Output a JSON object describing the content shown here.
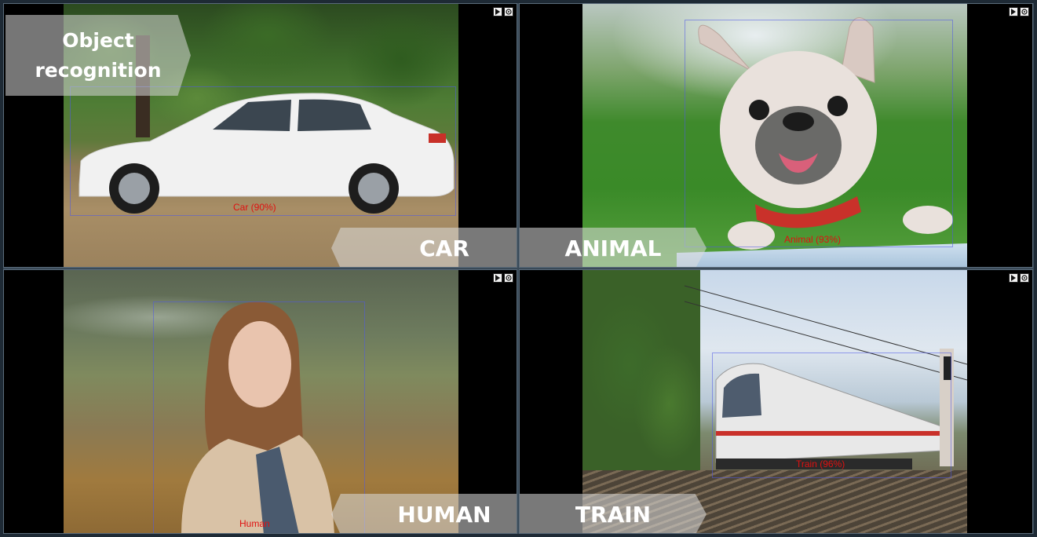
{
  "title": "Object\nrecognition",
  "title_lines": [
    "Object",
    "recognition"
  ],
  "cells": [
    {
      "id": "car",
      "banner": "CAR",
      "detection_label": "Car (90%)"
    },
    {
      "id": "animal",
      "banner": "ANIMAL",
      "detection_label": "Animal (93%)"
    },
    {
      "id": "human",
      "banner": "HUMAN",
      "detection_label": "Human"
    },
    {
      "id": "train",
      "banner": "TRAIN",
      "detection_label": "Train (96%)"
    }
  ],
  "controls": {
    "play_icon": "play-icon",
    "settings_icon": "settings-icon"
  },
  "colors": {
    "label_red": "#e01010",
    "banner_bg": "#dcdcdc",
    "frame": "#5a6b7a"
  }
}
